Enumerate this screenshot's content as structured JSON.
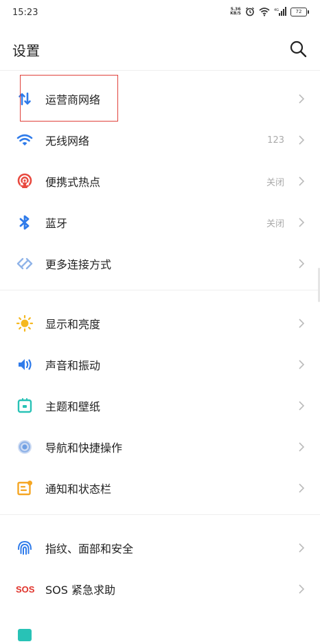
{
  "status": {
    "time": "15:23",
    "speed_top": "5.36",
    "speed_bottom": "KB/S",
    "battery": "72"
  },
  "header": {
    "title": "设置"
  },
  "items": [
    {
      "label": "运营商网络",
      "value": "",
      "icon": "carrier-network-icon"
    },
    {
      "label": "无线网络",
      "value": "123",
      "icon": "wifi-icon"
    },
    {
      "label": "便携式热点",
      "value": "关闭",
      "icon": "hotspot-icon"
    },
    {
      "label": "蓝牙",
      "value": "关闭",
      "icon": "bluetooth-icon"
    },
    {
      "label": "更多连接方式",
      "value": "",
      "icon": "more-connections-icon"
    },
    {
      "label": "显示和亮度",
      "value": "",
      "icon": "brightness-icon"
    },
    {
      "label": "声音和振动",
      "value": "",
      "icon": "sound-icon"
    },
    {
      "label": "主题和壁纸",
      "value": "",
      "icon": "theme-icon"
    },
    {
      "label": "导航和快捷操作",
      "value": "",
      "icon": "navigation-icon"
    },
    {
      "label": "通知和状态栏",
      "value": "",
      "icon": "notification-icon"
    },
    {
      "label": "指纹、面部和安全",
      "value": "",
      "icon": "fingerprint-icon"
    },
    {
      "label": "SOS 紧急求助",
      "value": "",
      "icon": "sos-icon"
    }
  ],
  "colors": {
    "accent_blue": "#2f7bea",
    "hotspot_red": "#e8493f",
    "sun_yellow": "#f5b820",
    "theme_teal": "#28c2b6",
    "notify_orange": "#f5a623",
    "sos_red": "#e0322a",
    "highlight_red": "#e0403a"
  }
}
